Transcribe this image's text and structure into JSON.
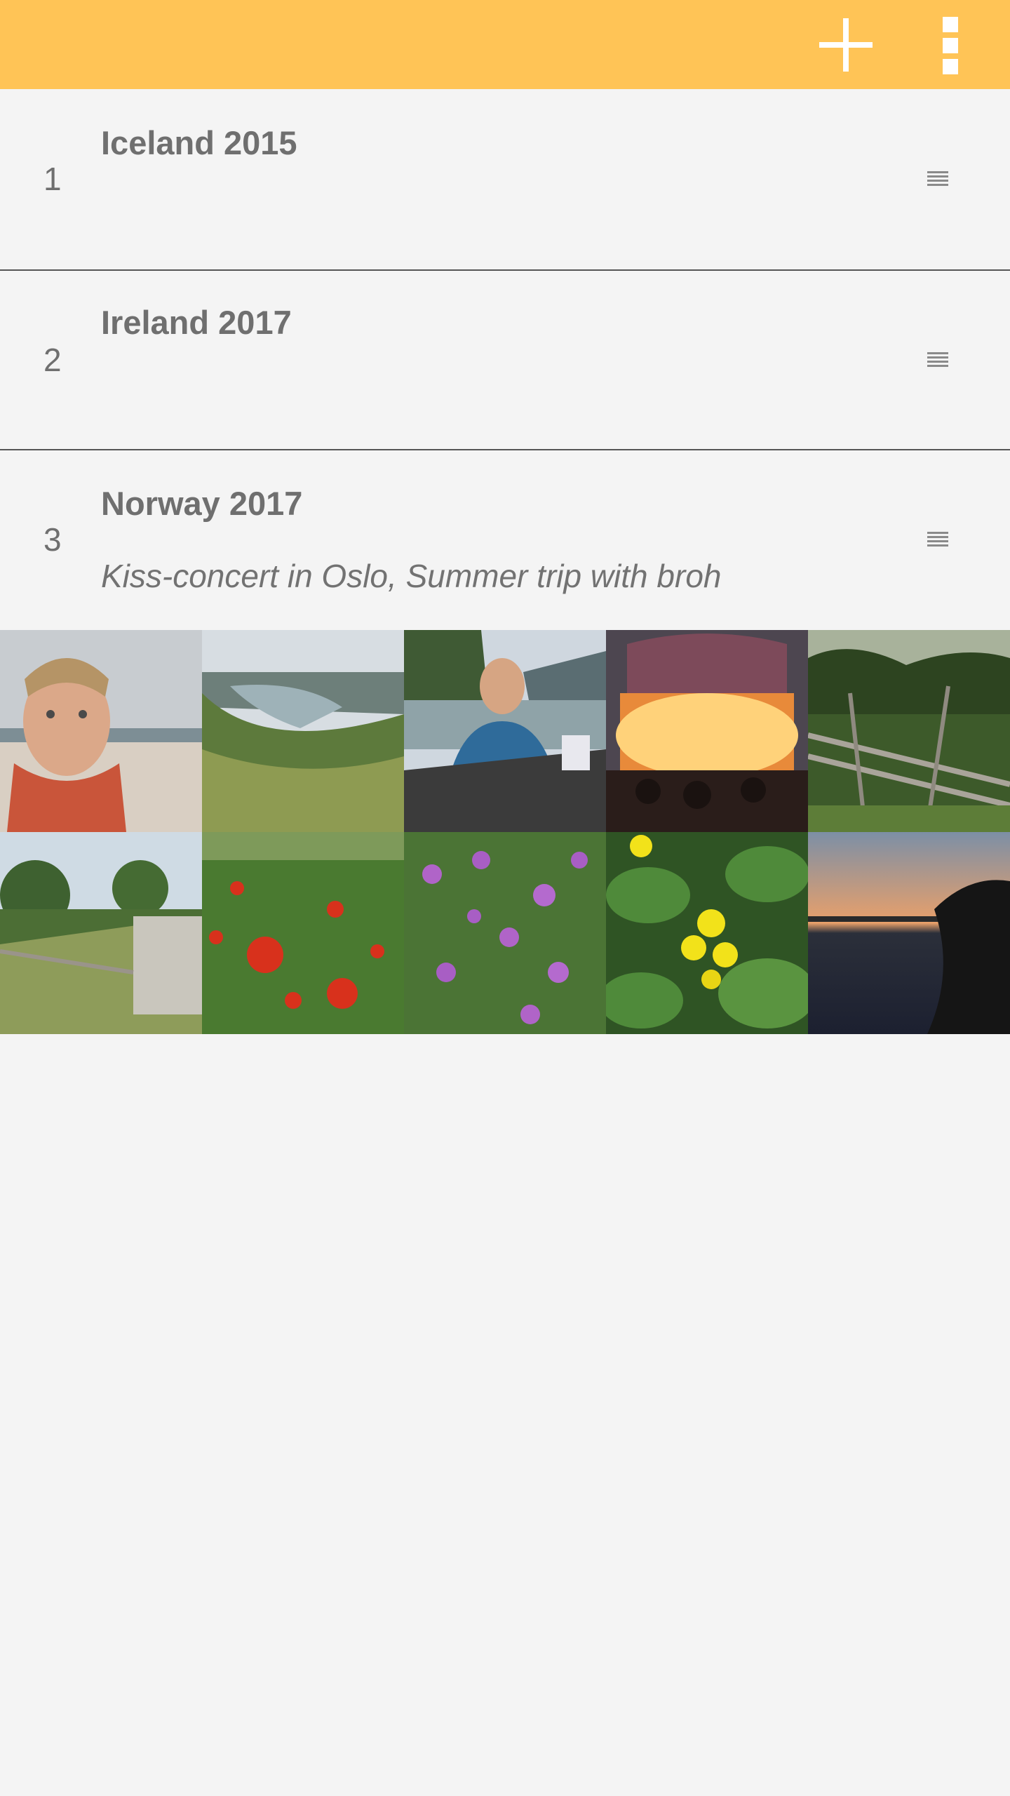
{
  "app_bar": {
    "color": "#ffc456",
    "actions": [
      {
        "name": "add-icon"
      },
      {
        "name": "more-vertical-icon"
      }
    ]
  },
  "trips": [
    {
      "number": "1",
      "title": "Iceland 2015",
      "description": ""
    },
    {
      "number": "2",
      "title": "Ireland 2017",
      "description": ""
    },
    {
      "number": "3",
      "title": "Norway 2017",
      "description": "Kiss-concert in Oslo, Summer trip with broh"
    }
  ],
  "photos": [
    {
      "name": "photo-selfie-beach"
    },
    {
      "name": "photo-fjord-valley"
    },
    {
      "name": "photo-man-at-table"
    },
    {
      "name": "photo-concert-stage"
    },
    {
      "name": "photo-wooden-fence"
    },
    {
      "name": "photo-stone-wall"
    },
    {
      "name": "photo-red-poppies"
    },
    {
      "name": "photo-purple-flowers"
    },
    {
      "name": "photo-yellow-flower"
    },
    {
      "name": "photo-sunset-lake"
    }
  ]
}
